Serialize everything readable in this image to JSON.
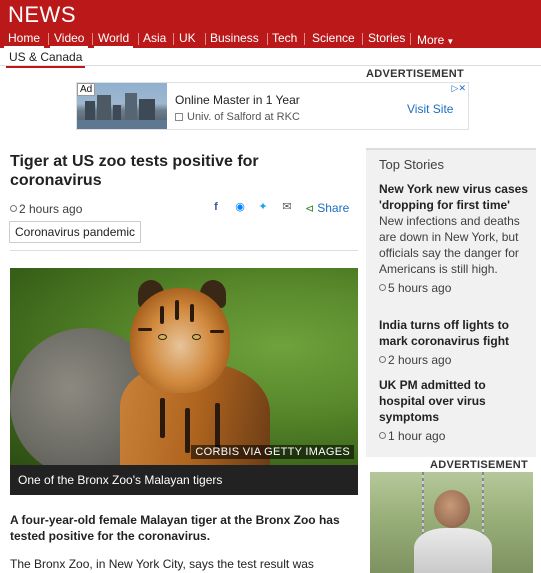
{
  "header": {
    "logo": "NEWS"
  },
  "nav": {
    "items": [
      {
        "label": "Home",
        "active": true
      },
      {
        "label": "Video",
        "active": true
      },
      {
        "label": "World",
        "active": true
      },
      {
        "label": "Asia",
        "active": false
      },
      {
        "label": "UK",
        "active": false
      },
      {
        "label": "Business",
        "active": false
      },
      {
        "label": "Tech",
        "active": false
      },
      {
        "label": "Science",
        "active": false
      },
      {
        "label": "Stories",
        "active": false
      }
    ],
    "more": "More"
  },
  "subnav": {
    "item": "US & Canada"
  },
  "top_ad": {
    "label": "ADVERTISEMENT",
    "badge": "Ad",
    "title": "Online Master in 1 Year",
    "subtitle": "Univ. of Salford at RKC",
    "cta": "Visit Site"
  },
  "article": {
    "headline": "Tiger at US zoo tests positive for coronavirus",
    "timestamp": "2 hours ago",
    "share": "Share",
    "tag": "Coronavirus pandemic",
    "photo_credit": "CORBIS VIA GETTY IMAGES",
    "caption": "One of the Bronx Zoo's Malayan tigers",
    "lead": "A four-year-old female Malayan tiger at the Bronx Zoo has tested positive for the coronavirus.",
    "body": "The Bronx Zoo, in New York City, says the test result was"
  },
  "sidebar": {
    "title": "Top Stories",
    "stories": [
      {
        "title": "New York new virus cases 'dropping for first time'",
        "summary": "New infections and deaths are down in New York, but officials say the danger for Americans is still high.",
        "time": "5 hours ago"
      },
      {
        "title": "India turns off lights to mark coronavirus fight",
        "summary": "",
        "time": "2 hours ago"
      },
      {
        "title": "UK PM admitted to hospital over virus symptoms",
        "summary": "",
        "time": "1 hour ago"
      }
    ]
  },
  "side_ad": {
    "label": "ADVERTISEMENT"
  },
  "colors": {
    "brand": "#bb1919",
    "link": "#1a6ec2"
  },
  "icons": [
    "facebook-icon",
    "messenger-icon",
    "twitter-icon",
    "email-icon",
    "share-icon",
    "clock-icon"
  ]
}
